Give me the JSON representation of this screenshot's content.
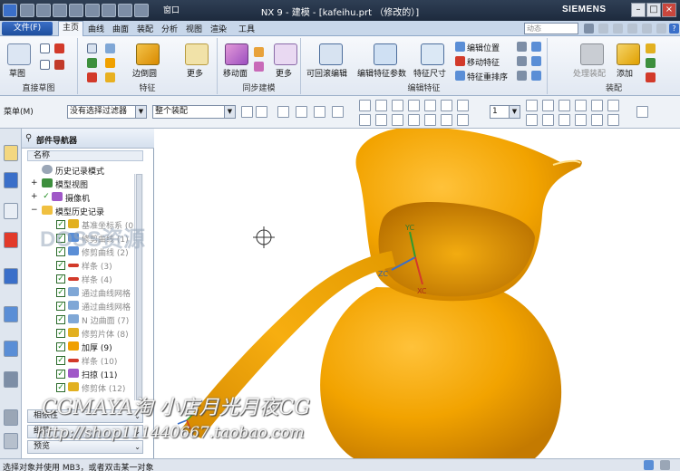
{
  "titlebar": {
    "title": "NX 9 - 建模 - [kafeihu.prt （修改的）]",
    "window_menu": "窗口",
    "brand": "SIEMENS",
    "min": "–",
    "max": "□",
    "close": "×"
  },
  "menu": {
    "file": "文件(F)",
    "tabs": [
      "主页",
      "曲线",
      "曲面",
      "装配",
      "分析",
      "视图",
      "渲染",
      "工具"
    ],
    "search_placeholder": "动态",
    "help": "?"
  },
  "ribbon": {
    "direct_sketch": {
      "sketch": "草图",
      "label": "直接草图"
    },
    "feature": {
      "edge_blend": "边倒圆",
      "more": "更多",
      "label": "特征"
    },
    "sync": {
      "move_face": "移动面",
      "more": "更多",
      "label": "同步建模"
    },
    "edit_feature": {
      "rollback_edit": "可回滚编辑",
      "edit_params": "编辑特征参数",
      "feature_dims": "特征尺寸",
      "edit_position": "编辑位置",
      "move_feature": "移动特征",
      "reorder": "特征重排序",
      "label": "编辑特征"
    },
    "assembly": {
      "wave_assembly": "处理装配",
      "add": "添加",
      "label": "装配"
    }
  },
  "toolbar2": {
    "menu": "菜单(M)",
    "filter": "没有选择过滤器",
    "scope": "整个装配",
    "layer": "1"
  },
  "navigator": {
    "title": "部件导航器",
    "column": "名称",
    "rows": [
      {
        "label": "历史记录模式"
      },
      {
        "label": "模型视图"
      },
      {
        "label": "摄像机"
      },
      {
        "label": "模型历史记录"
      },
      {
        "label": "基准坐标系 (0)"
      },
      {
        "label": "修剪曲线 (1)"
      },
      {
        "label": "修剪曲线 (2)"
      },
      {
        "label": "样条 (3)"
      },
      {
        "label": "样条 (4)"
      },
      {
        "label": "通过曲线网格"
      },
      {
        "label": "通过曲线网格"
      },
      {
        "label": "N 边曲面 (7)"
      },
      {
        "label": "修剪片体 (8)"
      },
      {
        "label": "加厚 (9)"
      },
      {
        "label": "样条 (10)"
      },
      {
        "label": "扫掠 (11)"
      },
      {
        "label": "修剪体 (12)"
      }
    ],
    "panes": [
      "相依性",
      "细节",
      "预览"
    ]
  },
  "viewport": {
    "axis_yc": "YC",
    "axis_zc": "ZC",
    "axis_xc": "XC"
  },
  "watermarks": {
    "brand": "DOSS资源",
    "shop": "CGMAYA淘 小店月光月夜CG",
    "url": "http://shop111440667.taobao.com"
  },
  "status": {
    "text": "选择对象并使用 MB3，或者双击某一对象"
  },
  "colors": {
    "model": "#f2a300",
    "titlebar": "#1d2a3d",
    "ribbon": "#e1e8f2"
  }
}
